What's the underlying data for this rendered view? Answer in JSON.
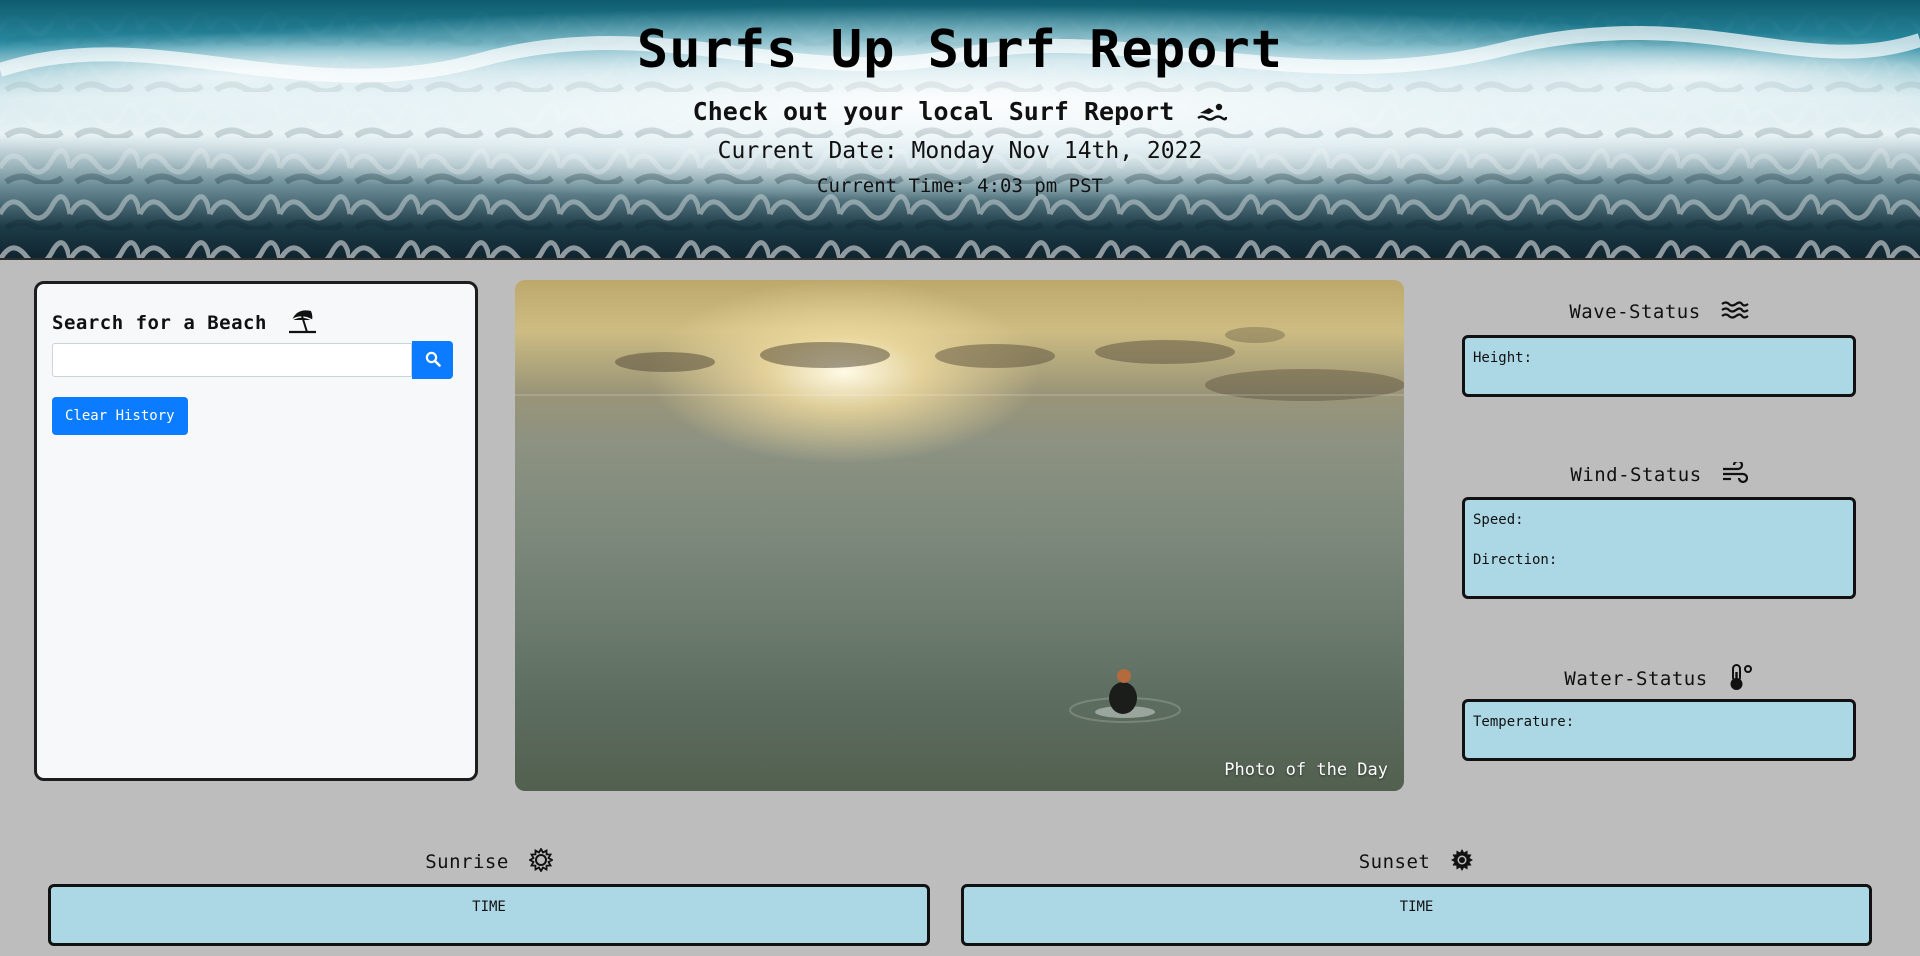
{
  "header": {
    "title": "Surfs Up Surf Report",
    "subtitle": "Check out your local Surf Report",
    "subtitle_icon": "swimmer-icon",
    "current_date": "Current Date: Monday Nov 14th, 2022",
    "current_time": "Current Time: 4:03 pm PST"
  },
  "search": {
    "heading": "Search for a Beach",
    "heading_icon": "umbrella-beach-icon",
    "input_value": "",
    "placeholder": "",
    "search_icon": "search-icon",
    "clear_label": "Clear History"
  },
  "photo": {
    "caption": "Photo of the Day"
  },
  "wave": {
    "heading": "Wave-Status",
    "icon": "water-icon",
    "height_label": "Height:"
  },
  "wind": {
    "heading": "Wind-Status",
    "icon": "wind-icon",
    "speed_label": "Speed:",
    "direction_label": "Direction:"
  },
  "water": {
    "heading": "Water-Status",
    "icon": "temperature-icon",
    "temperature_label": "Temperature:"
  },
  "sunrise": {
    "heading": "Sunrise",
    "icon": "sun-outline-icon",
    "value": "TIME"
  },
  "sunset": {
    "heading": "Sunset",
    "icon": "sun-solid-icon",
    "value": "TIME"
  },
  "colors": {
    "page_bg": "#bdbdbd",
    "status_box_bg": "#acd8e6",
    "button_blue": "#0b7bff",
    "panel_bg": "#f7f8fa"
  }
}
